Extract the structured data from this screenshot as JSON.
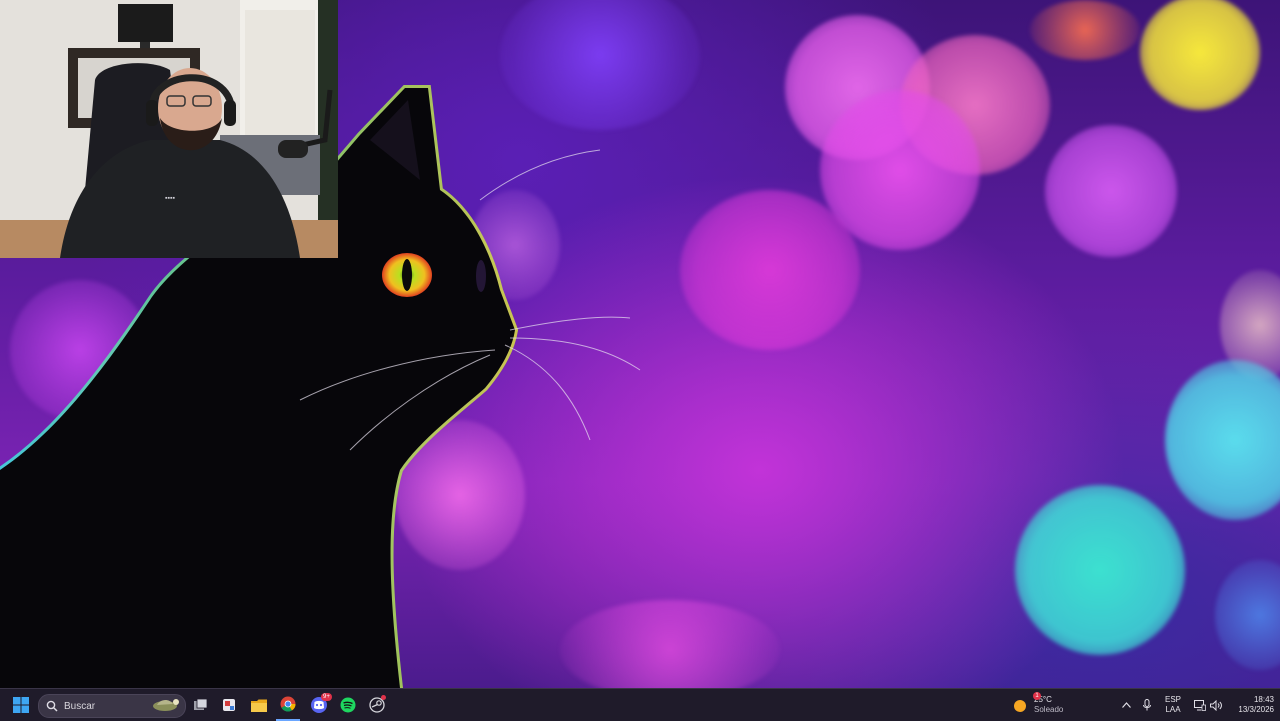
{
  "taskbar": {
    "search_placeholder": "Buscar",
    "weather": {
      "temp": "25°C",
      "condition": "Soleado",
      "badge": "1"
    },
    "language": {
      "lang": "ESP",
      "layout": "LAA"
    },
    "clock": {
      "time": "18:43",
      "date": "13/3/2026"
    },
    "discord_badge": "9+",
    "pinned_apps": [
      "task-view",
      "snipping-tool",
      "file-explorer",
      "google-chrome",
      "discord",
      "spotify",
      "steam"
    ]
  },
  "colors": {
    "taskbar_bg": "#1f1b2a",
    "accent": "#0078d4",
    "wallpaper_primary": "#7a23b3",
    "bokeh_magenta": "#e24ce8",
    "bokeh_cyan": "#3ee0d8",
    "bokeh_yellow": "#f2e23a"
  }
}
